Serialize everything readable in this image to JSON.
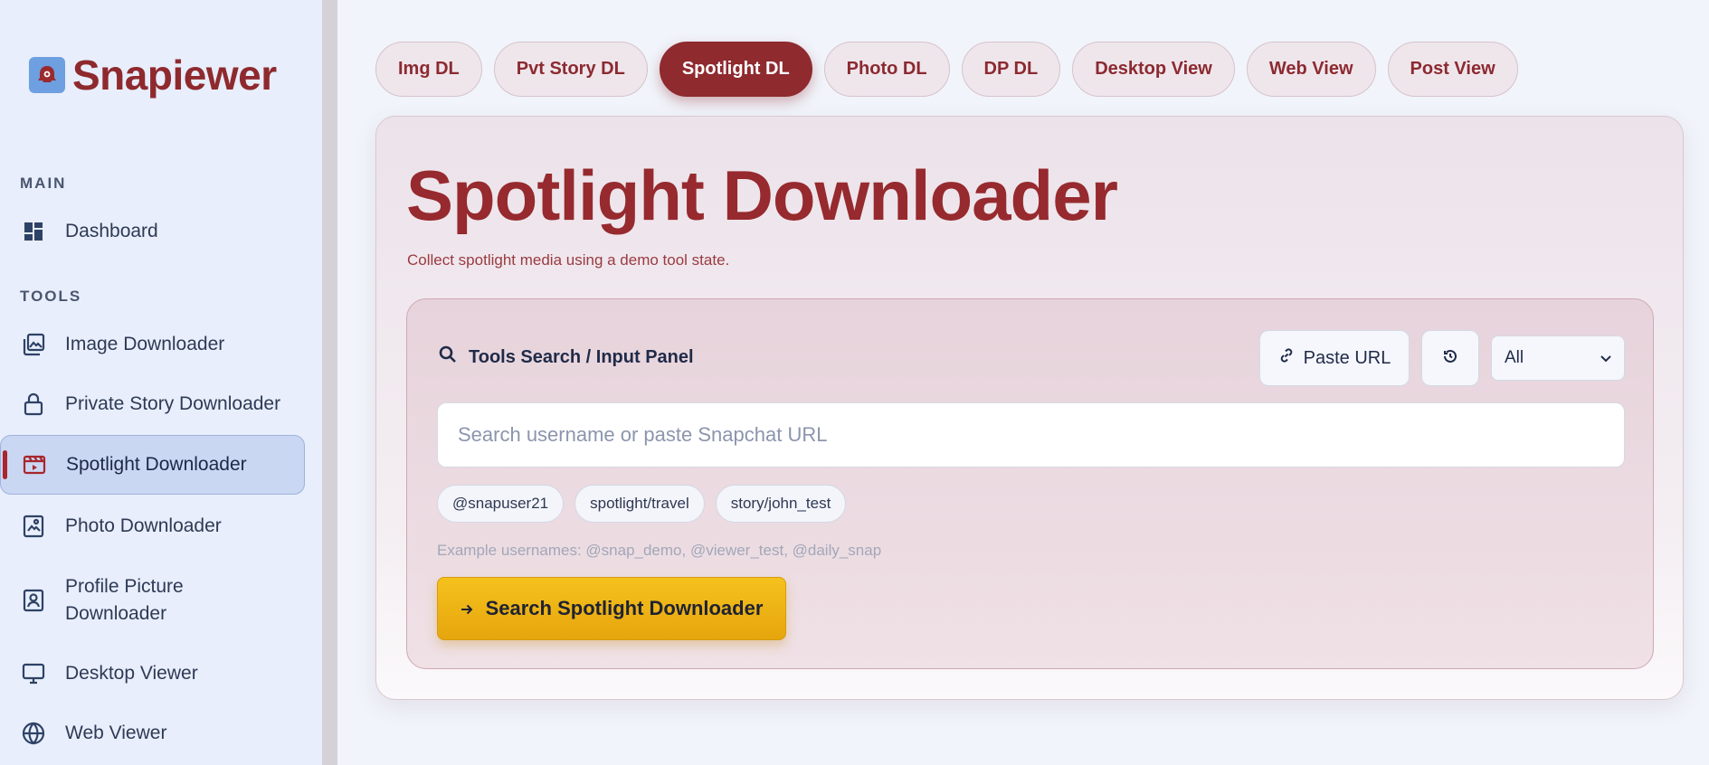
{
  "brand": {
    "name": "Snapiewer"
  },
  "sidebar": {
    "sections": [
      {
        "label": "MAIN"
      },
      {
        "label": "TOOLS"
      }
    ],
    "items": [
      {
        "label": "Dashboard",
        "icon": "dashboard-icon"
      },
      {
        "label": "Image Downloader",
        "icon": "image-stack-icon"
      },
      {
        "label": "Private Story Downloader",
        "icon": "lock-icon"
      },
      {
        "label": "Spotlight Downloader",
        "icon": "video-clip-icon",
        "active": true
      },
      {
        "label": "Photo Downloader",
        "icon": "photo-icon"
      },
      {
        "label": "Profile Picture",
        "label2": "Downloader",
        "icon": "portrait-icon"
      },
      {
        "label": "Desktop Viewer",
        "icon": "monitor-icon"
      },
      {
        "label": "Web Viewer",
        "icon": "globe-icon"
      }
    ]
  },
  "tabs": [
    {
      "label": "Img DL"
    },
    {
      "label": "Pvt Story DL"
    },
    {
      "label": "Spotlight DL",
      "active": true
    },
    {
      "label": "Photo DL"
    },
    {
      "label": "DP DL"
    },
    {
      "label": "Desktop View"
    },
    {
      "label": "Web View"
    },
    {
      "label": "Post View"
    }
  ],
  "main": {
    "title": "Spotlight Downloader",
    "subtitle": "Collect spotlight media using a demo tool state."
  },
  "panel": {
    "heading": "Tools Search / Input Panel",
    "paste_label": "Paste URL",
    "filter_value": "All",
    "search_placeholder": "Search username or paste Snapchat URL",
    "chips": [
      "@snapuser21",
      "spotlight/travel",
      "story/john_test"
    ],
    "examples": "Example usernames: @snap_demo, @viewer_test, @daily_snap",
    "search_button": "Search Spotlight Downloader"
  },
  "colors": {
    "brand": "#8e2a2e",
    "accent": "#962a2e",
    "active_tab": "#8f2a2f",
    "search_button": "#f5c21d",
    "sidebar_bg": "#e8eefb",
    "active_nav_bg": "#cad7f3"
  }
}
